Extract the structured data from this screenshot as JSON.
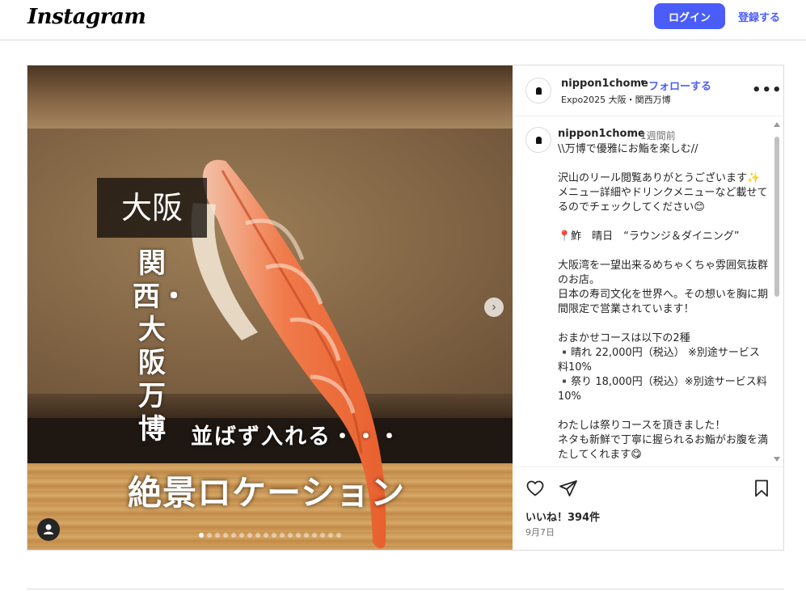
{
  "header": {
    "logo": "Instagram",
    "login_label": "ログイン",
    "signup_label": "登録する"
  },
  "post": {
    "username": "nippon1chome",
    "separator": "•",
    "follow_label": "フォローする",
    "location": "Expo2025 大阪・関西万博",
    "more_label": "•••",
    "media_overlay": {
      "osaka": "大阪",
      "vertical": "関西・大阪万博",
      "narabazu": "並ばず入れる・・・",
      "zekkei": "絶景ロケーション"
    },
    "carousel": {
      "total_slides": 18,
      "active_index": 0
    },
    "caption": {
      "username": "nippon1chome",
      "time": "1週間前",
      "text": "\\\\万博で優雅にお鮨を楽しむ//\n\n沢山のリール閲覧ありがとうございます✨ メニュー詳細やドリンクメニューなど載せてるのでチェックしてください😊\n\n📍鮓　晴日　“ラウンジ＆ダイニング”\n\n大阪湾を一望出来るめちゃくちゃ雰囲気抜群のお店。\n日本の寿司文化を世界へ。その想いを胸に期間限定で営業されています！\n\nおまかせコースは以下の2種\n▪️晴れ 22,000円（税込） ※別途サービス料10%\n▪️祭り 18,000円（税込）※別途サービス料10%\n\nわたしは祭りコースを頂きました！\nネタも新鮮で丁寧に握られるお鮨がお腹を満たしてくれます😋"
    },
    "likes": "いいね！394件",
    "date": "9月7日"
  },
  "icons": {
    "next": "chevron-right-icon",
    "like": "heart-icon",
    "share": "paper-plane-icon",
    "save": "bookmark-icon",
    "more": "more-horizontal-icon",
    "user_tag": "user-tag-icon"
  },
  "colors": {
    "accent": "#4a5df9",
    "border": "#dbdbdb",
    "muted": "#737373"
  }
}
